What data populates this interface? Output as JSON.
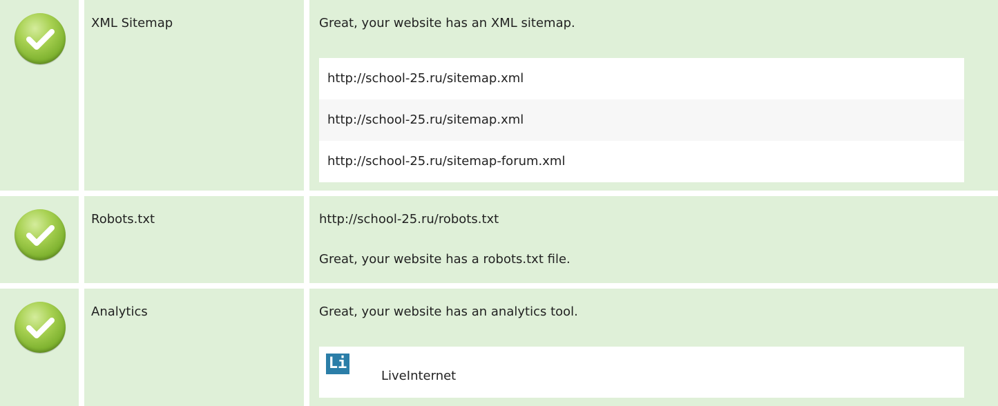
{
  "sitemap": {
    "label": "XML Sitemap",
    "message": "Great, your website has an XML sitemap.",
    "urls": [
      "http://school-25.ru/sitemap.xml",
      "http://school-25.ru/sitemap.xml",
      "http://school-25.ru/sitemap-forum.xml"
    ]
  },
  "robots": {
    "label": "Robots.txt",
    "url": "http://school-25.ru/robots.txt",
    "message": "Great, your website has a robots.txt file."
  },
  "analytics": {
    "label": "Analytics",
    "message": "Great, your website has an analytics tool.",
    "tool_logo_text": "Li",
    "tool_name": "LiveInternet"
  },
  "colors": {
    "row_background": "#dff0d8",
    "check_green": "#8cc63f",
    "logo_blue": "#2b7ea8"
  },
  "icons": {
    "status": "check-circle-icon",
    "analytics_tool": "liveinternet-logo"
  }
}
